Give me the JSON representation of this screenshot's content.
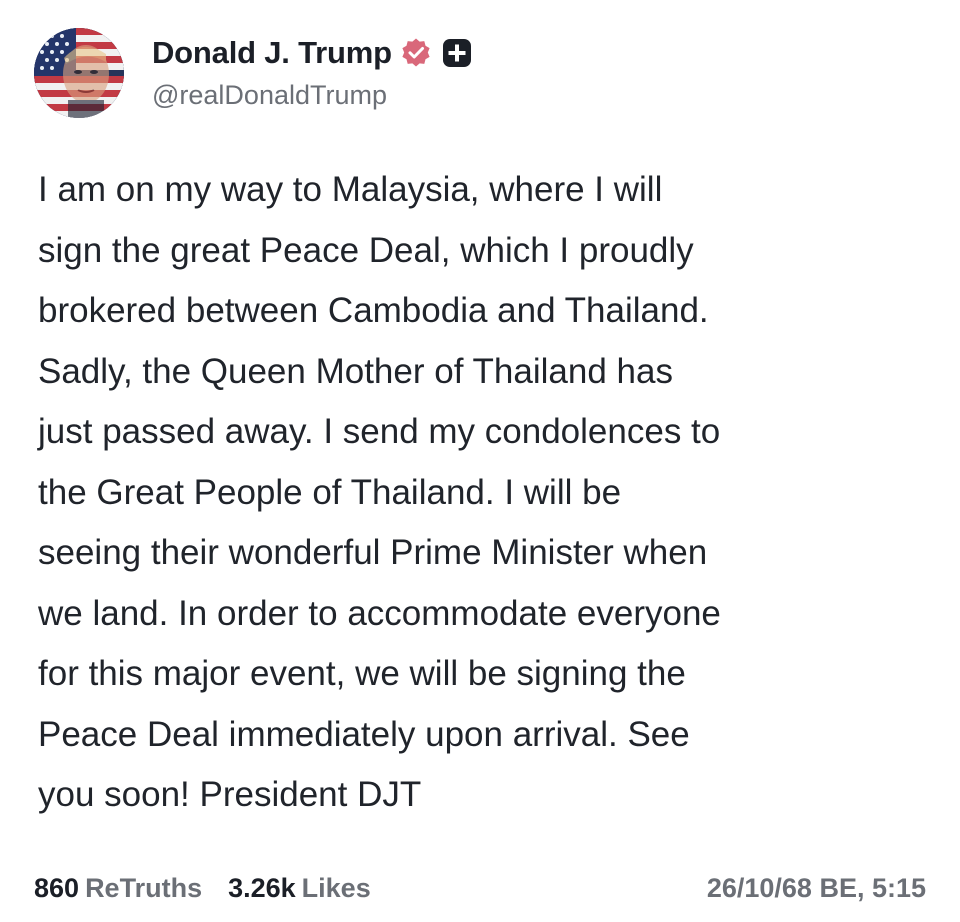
{
  "post": {
    "author": {
      "display_name": "Donald J. Trump",
      "handle": "@realDonaldTrump",
      "verified_icon": "verified-badge-icon",
      "plus_icon": "plus-badge-icon",
      "verified_color": "#d9687a",
      "plus_color": "#1b1f27"
    },
    "body_lines": [
      "I am on my way to Malaysia, where I will",
      "sign the great Peace Deal, which I proudly",
      "brokered between Cambodia and Thailand.",
      "Sadly, the Queen Mother of Thailand has",
      "just passed away. I send my condolences to",
      "the Great People of Thailand. I will be",
      "seeing their wonderful Prime Minister when",
      "we land. In order to accommodate everyone",
      "for this major event, we will be signing the",
      "Peace Deal immediately upon arrival. See",
      "you soon! President DJT"
    ],
    "stats": {
      "retruths_count": "860",
      "retruths_label": "ReTruths",
      "likes_count": "3.26k",
      "likes_label": "Likes"
    },
    "timestamp": "26/10/68 BE, 5:15"
  }
}
